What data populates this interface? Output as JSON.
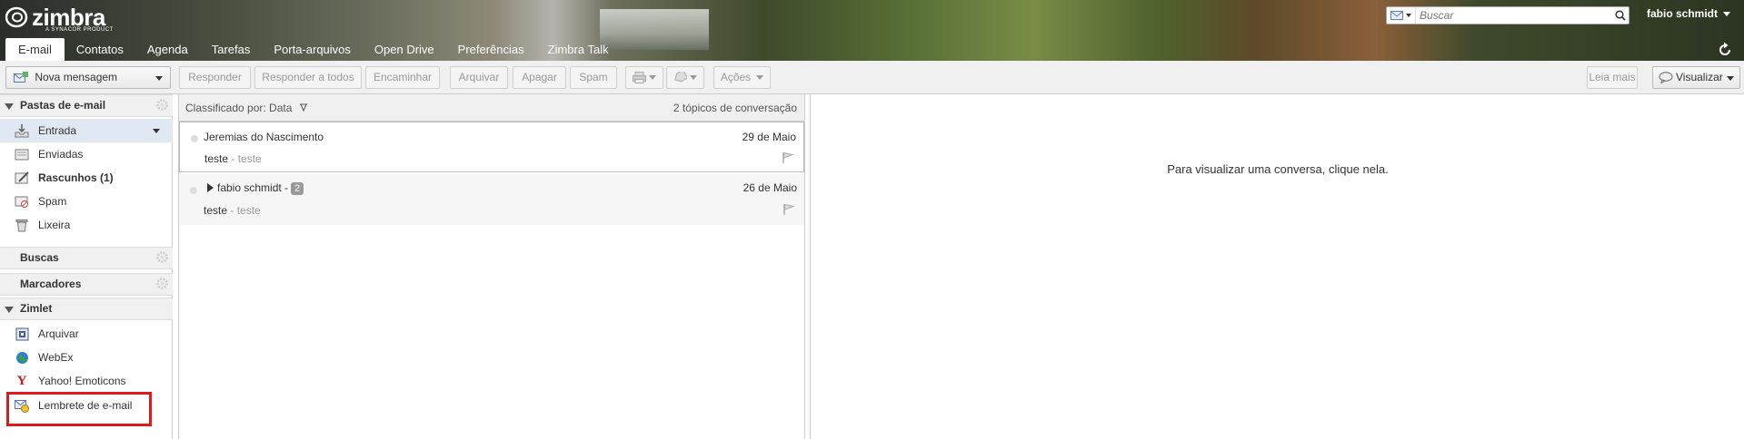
{
  "header": {
    "logo_text": "zimbra",
    "logo_sub": "A SYNACOR PRODUCT",
    "search_placeholder": "Buscar",
    "user_name": "fabio schmidt"
  },
  "app_tabs": [
    {
      "label": "E-mail",
      "active": true
    },
    {
      "label": "Contatos"
    },
    {
      "label": "Agenda"
    },
    {
      "label": "Tarefas"
    },
    {
      "label": "Porta-arquivos"
    },
    {
      "label": "Open Drive"
    },
    {
      "label": "Preferências"
    },
    {
      "label": "Zimbra Talk"
    }
  ],
  "toolbar": {
    "new_message": "Nova mensagem",
    "reply": "Responder",
    "reply_all": "Responder a todos",
    "forward": "Encaminhar",
    "archive": "Arquivar",
    "delete": "Apagar",
    "spam": "Spam",
    "actions": "Ações",
    "read_more": "Leia mais",
    "view": "Visualizar"
  },
  "sidebar": {
    "mail_folders_title": "Pastas de e-mail",
    "folders": [
      {
        "label": "Entrada",
        "icon": "inbox-icon"
      },
      {
        "label": "Enviadas",
        "icon": "sent-icon"
      },
      {
        "label": "Rascunhos (1)",
        "icon": "drafts-icon"
      },
      {
        "label": "Spam",
        "icon": "junk-icon"
      },
      {
        "label": "Lixeira",
        "icon": "trash-icon"
      }
    ],
    "searches_title": "Buscas",
    "tags_title": "Marcadores",
    "zimlets_title": "Zimlet",
    "zimlets": [
      {
        "label": "Arquivar",
        "icon": "archive-zimlet-icon"
      },
      {
        "label": "WebEx",
        "icon": "webex-globe-icon"
      },
      {
        "label": "Yahoo! Emoticons",
        "icon": "yahoo-y-icon"
      },
      {
        "label": "Lembrete de e-mail",
        "icon": "email-reminder-icon"
      }
    ]
  },
  "list": {
    "sort_label": "Classificado por: Data",
    "count_label": "2 tópicos de conversação",
    "conversations": [
      {
        "from": "Jeremias do Nascimento",
        "date": "29 de Maio",
        "subject": "teste",
        "fragment": "teste",
        "count": ""
      },
      {
        "from": "fabio schmidt -",
        "date": "26 de Maio",
        "subject": "teste",
        "fragment": "teste",
        "count": "2"
      }
    ]
  },
  "reading_pane": {
    "hint": "Para visualizar uma conversa, clique nela."
  },
  "colors": {
    "highlight_box": "#e0191d",
    "selected_folder": "#dfe8f3"
  }
}
